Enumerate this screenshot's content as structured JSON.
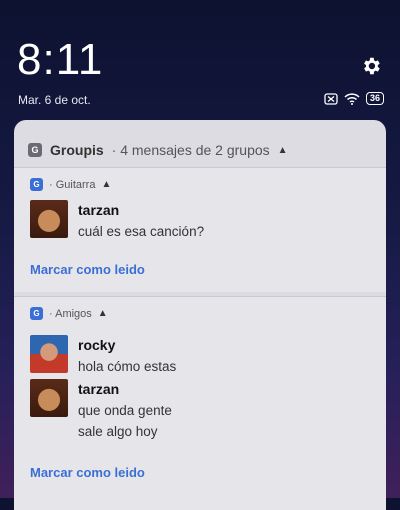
{
  "status_bar": {
    "time": "8:11",
    "date": "Mar. 6 de oct.",
    "battery": "36"
  },
  "notification": {
    "app_icon_letter": "G",
    "app_name": "Groupis",
    "summary": "· 4 mensajes de 2 grupos",
    "groups": [
      {
        "icon_letter": "G",
        "name": "· Guitarra",
        "messages": [
          {
            "sender": "tarzan",
            "lines": [
              "cuál es esa canción?"
            ]
          }
        ],
        "action": "Marcar como leido"
      },
      {
        "icon_letter": "G",
        "name": "· Amigos",
        "messages": [
          {
            "sender": "rocky",
            "lines": [
              "hola cómo estas"
            ]
          },
          {
            "sender": "tarzan",
            "lines": [
              "que onda gente",
              "sale algo hoy"
            ]
          }
        ],
        "action": "Marcar como leido"
      }
    ]
  },
  "colors": {
    "accent": "#3b6fd6",
    "panel": "#e6e6ea"
  }
}
